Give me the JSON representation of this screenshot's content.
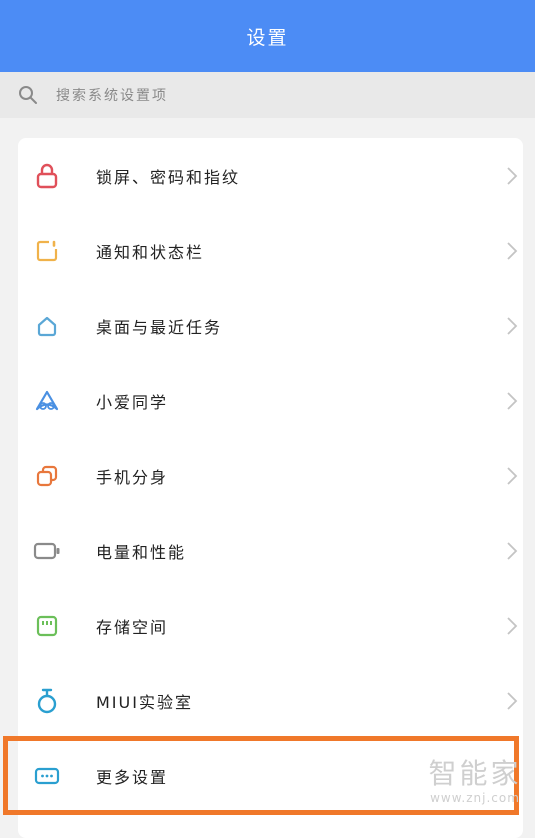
{
  "header": {
    "title": "设置",
    "background": "#4c8cf5"
  },
  "search": {
    "icon": "search-icon",
    "placeholder": "搜索系统设置项"
  },
  "settings": {
    "items": [
      {
        "label": "锁屏、密码和指纹",
        "icon": "lock-icon",
        "color": "#e0505a"
      },
      {
        "label": "通知和状态栏",
        "icon": "notification-icon",
        "color": "#f0b24a"
      },
      {
        "label": "桌面与最近任务",
        "icon": "home-icon",
        "color": "#5aa7d6"
      },
      {
        "label": "小爱同学",
        "icon": "xiaoai-icon",
        "color": "#4a90e2"
      },
      {
        "label": "手机分身",
        "icon": "dual-apps-icon",
        "color": "#e8773c"
      },
      {
        "label": "电量和性能",
        "icon": "battery-icon",
        "color": "#8a8a8a"
      },
      {
        "label": "存储空间",
        "icon": "storage-icon",
        "color": "#6bbf59"
      },
      {
        "label": "MIUI实验室",
        "icon": "lab-icon",
        "color": "#2a9fd0"
      },
      {
        "label": "更多设置",
        "icon": "more-icon",
        "color": "#2a9fd0"
      }
    ]
  },
  "highlight": {
    "color": "#f0782a"
  },
  "watermark": {
    "main": "智能家",
    "url": "www.znj.com"
  }
}
